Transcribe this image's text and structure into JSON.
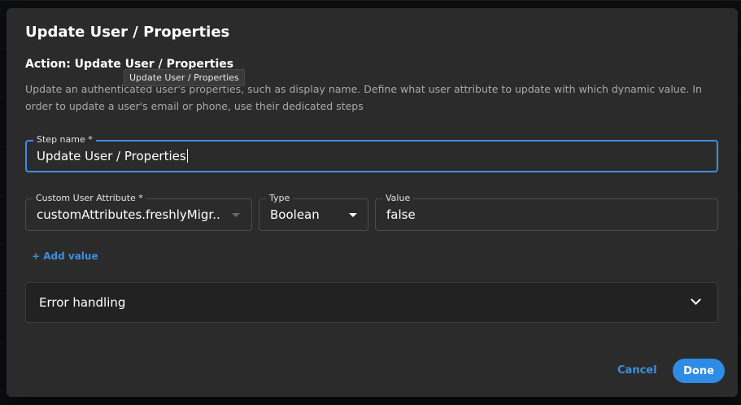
{
  "dialog": {
    "title": "Update User / Properties",
    "action_title": "Action: Update User / Properties",
    "tooltip": "Update User / Properties",
    "description": "Update an authenticated user's properties, such as display name. Define what user attribute to update with which dynamic value. In order to update a user's email or phone, use their dedicated steps"
  },
  "step_name": {
    "label": "Step name *",
    "value": "Update User / Properties"
  },
  "attribute_row": {
    "attribute": {
      "label": "Custom User Attribute *",
      "value": "customAttributes.freshlyMigr..."
    },
    "type": {
      "label": "Type",
      "value": "Boolean"
    },
    "value": {
      "label": "Value",
      "value": "false"
    }
  },
  "add_value_label": "+ Add value",
  "error_handling_label": "Error handling",
  "footer": {
    "cancel_label": "Cancel",
    "done_label": "Done"
  },
  "colors": {
    "accent": "#2e8ce6",
    "dialog_bg": "#2b2b2b"
  },
  "icons": {
    "dropdown": "chevron-down-icon",
    "accordion": "chevron-down-icon"
  }
}
